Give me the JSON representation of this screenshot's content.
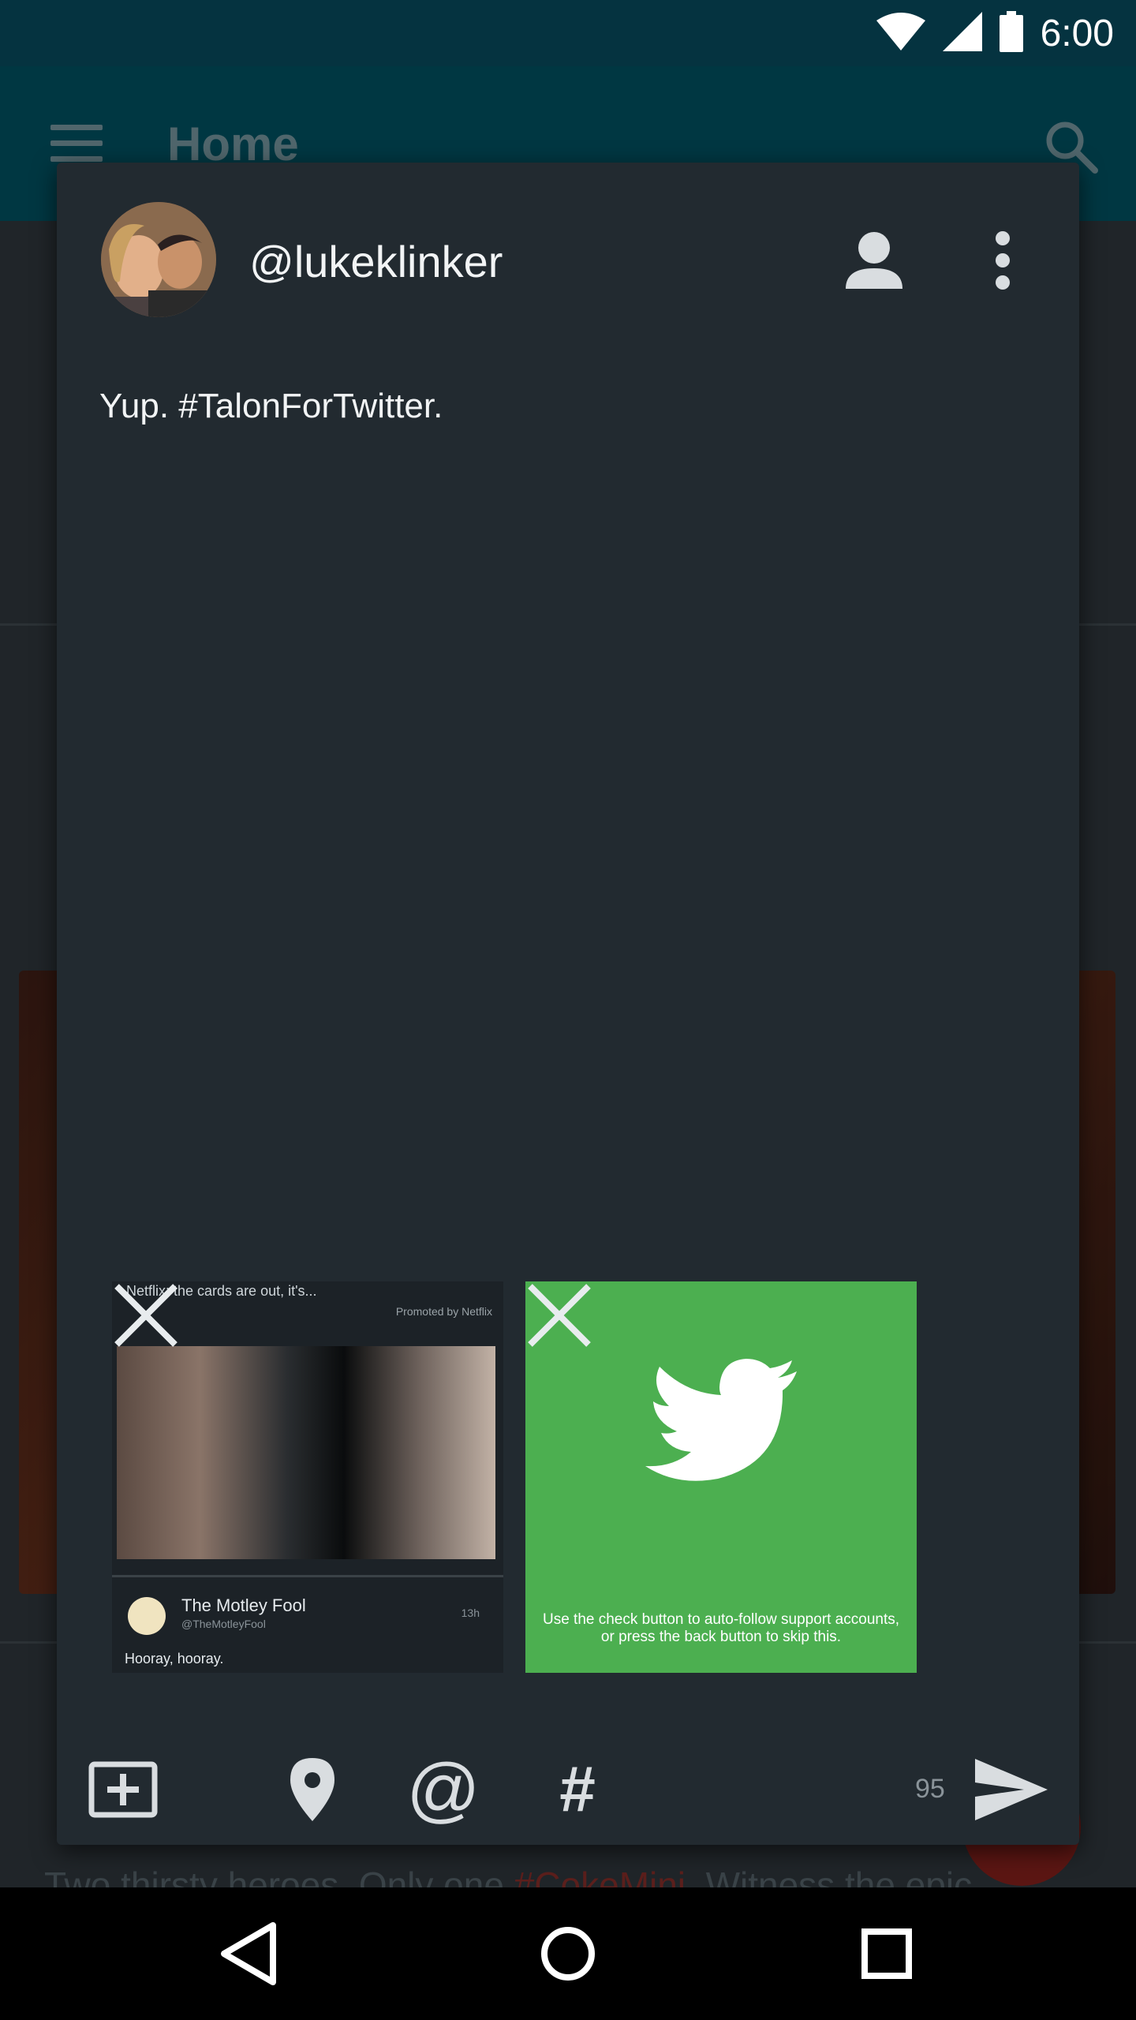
{
  "status_bar": {
    "time": "6:00",
    "wifi_icon": "wifi-icon",
    "signal_icon": "cell-signal-icon",
    "battery_icon": "battery-icon"
  },
  "app_bar": {
    "title": "Home",
    "menu_icon": "hamburger-menu-icon",
    "search_icon": "search-icon"
  },
  "feed": {
    "bottom_text_prefix": "Two thirsty heroes. Only one ",
    "bottom_text_hashtag": "#CokeMini",
    "bottom_text_suffix": ". Witness the epic"
  },
  "compose": {
    "username": "@lukeklinker",
    "tweet_text": "Yup. #TalonForTwitter.",
    "account_icon": "person-icon",
    "overflow_icon": "more-vert-icon",
    "attachments": [
      {
        "type": "screenshot",
        "top_text": "Netflix: the cards are out, it's...",
        "top_right_text": "Promoted by Netflix",
        "author_name": "The Motley Fool",
        "author_handle": "@TheMotleyFool",
        "time": "13h",
        "body": "Hooray, hooray."
      },
      {
        "type": "image",
        "caption": "Use the check button to auto-follow support accounts, or press the back button to skip this.",
        "bg_color": "#4caf50"
      }
    ],
    "toolbar": {
      "add_image_icon": "add-image-icon",
      "location_icon": "location-pin-icon",
      "mention_glyph": "@",
      "hashtag_glyph": "#",
      "char_count": "95",
      "send_icon": "send-icon"
    }
  },
  "nav_bar": {
    "back_icon": "back-icon",
    "home_icon": "home-icon",
    "recents_icon": "recents-icon"
  },
  "colors": {
    "status_bar": "#053340",
    "app_bar": "#004a58",
    "dialog": "#222a30",
    "accent_green": "#4caf50"
  }
}
